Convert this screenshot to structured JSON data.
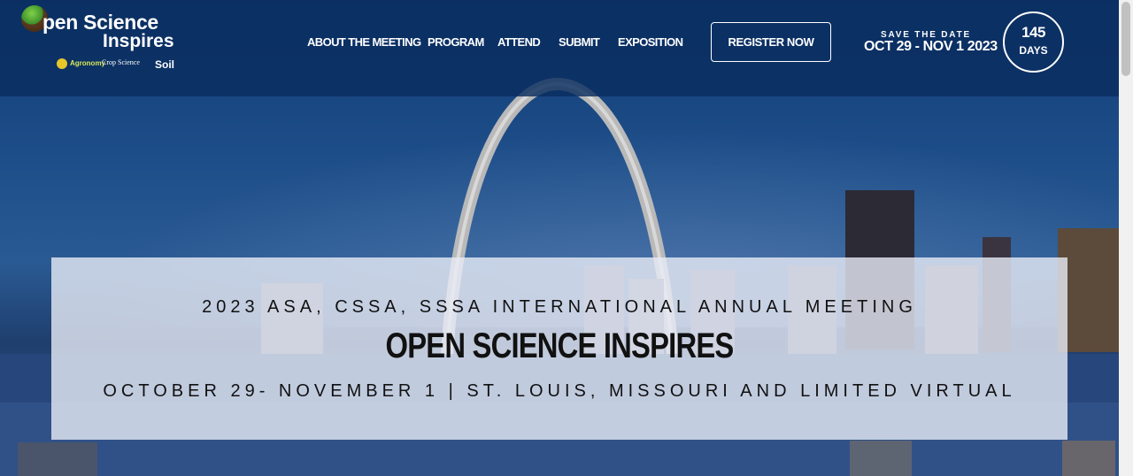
{
  "logo": {
    "line1": "pen Science",
    "line1_first_letter": "O",
    "line2": "Inspires",
    "sponsors": [
      "Agronomy",
      "Crop Science",
      "Soil"
    ]
  },
  "nav": {
    "items": [
      "ABOUT THE MEETING",
      "PROGRAM",
      "ATTEND",
      "SUBMIT",
      "EXPOSITION"
    ]
  },
  "register": {
    "label": "REGISTER NOW"
  },
  "save_the_date": {
    "label": "SAVE THE DATE",
    "dates": "OCT 29 - NOV 1 2023"
  },
  "countdown": {
    "value": "145",
    "unit": "DAYS"
  },
  "banner": {
    "subtitle": "2023 ASA, CSSA, SSSA INTERNATIONAL ANNUAL MEETING",
    "title": "OPEN SCIENCE INSPIRES",
    "date_location": "OCTOBER 29- NOVEMBER 1 | ST. LOUIS, MISSOURI AND LIMITED VIRTUAL"
  },
  "colors": {
    "header_bg": "#0a2d5f",
    "banner_bg": "#e8ecf6",
    "text_dark": "#111111"
  }
}
